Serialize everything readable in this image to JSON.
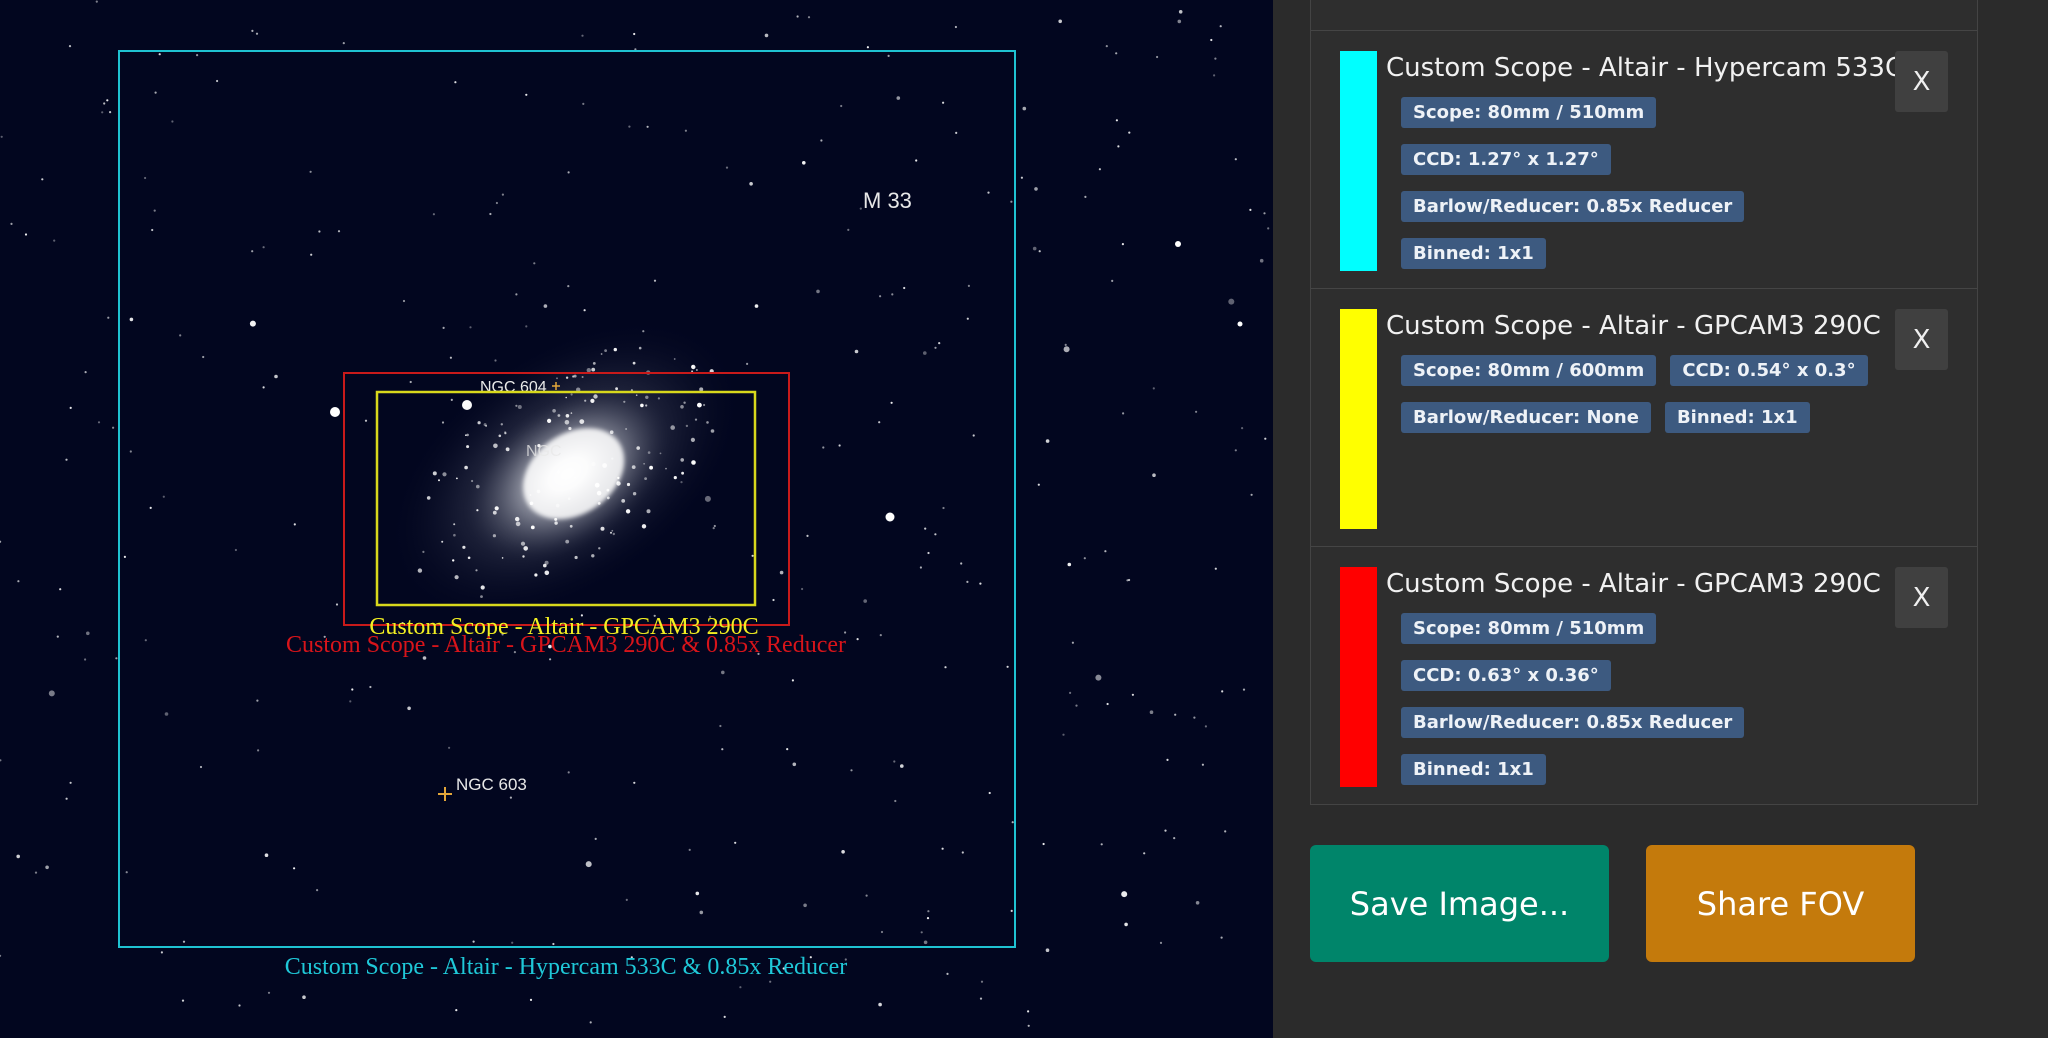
{
  "sky": {
    "object_labels": [
      "M 33",
      "NGC 604",
      "NGC 603",
      "NGC"
    ],
    "fov_labels": {
      "cyan": "Custom Scope - Altair - Hypercam 533C  & 0.85x Reducer",
      "yellow": "Custom Scope - Altair - GPCAM3 290C",
      "red": "Custom Scope - Altair - GPCAM3 290C  & 0.85x Reducer"
    }
  },
  "fov_list": [
    {
      "color": "#00ffff",
      "title": "Custom Scope - Altair - Hypercam 533C",
      "scope": "Scope: 80mm / 510mm",
      "ccd": "CCD: 1.27° x 1.27°",
      "barlow": "Barlow/Reducer: 0.85x Reducer",
      "binned": "Binned: 1x1",
      "remove_label": "X"
    },
    {
      "color": "#ffff00",
      "title": "Custom Scope - Altair - GPCAM3 290C",
      "scope": "Scope: 80mm / 600mm",
      "ccd": "CCD: 0.54° x 0.3°",
      "barlow": "Barlow/Reducer: None",
      "binned": "Binned: 1x1",
      "remove_label": "X"
    },
    {
      "color": "#ff0000",
      "title": "Custom Scope - Altair - GPCAM3 290C",
      "scope": "Scope: 80mm / 510mm",
      "ccd": "CCD: 0.63° x 0.36°",
      "barlow": "Barlow/Reducer: 0.85x Reducer",
      "binned": "Binned: 1x1",
      "remove_label": "X"
    }
  ],
  "actions": {
    "save_label": "Save Image...",
    "share_label": "Share FOV"
  }
}
